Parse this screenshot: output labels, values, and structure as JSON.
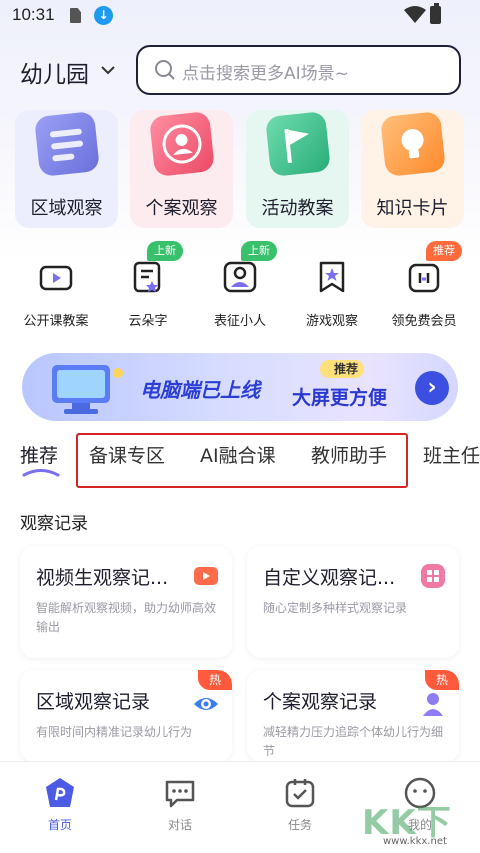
{
  "status_bar": {
    "time": "10:31"
  },
  "header": {
    "location": "幼儿园",
    "search_placeholder": "点击搜索更多AI场景~"
  },
  "scene_cards": [
    {
      "label": "区域观察",
      "bg": "#eceefe",
      "accent": "#7d82e8"
    },
    {
      "label": "个案观察",
      "bg": "#fdecef",
      "accent": "#f2637a"
    },
    {
      "label": "活动教案",
      "bg": "#e6f6f0",
      "accent": "#3dbf8a"
    },
    {
      "label": "知识卡片",
      "bg": "#fff2e6",
      "accent": "#ff9a3c"
    }
  ],
  "quick_entries": [
    {
      "label": "公开课教案",
      "icon": "video-lesson-icon"
    },
    {
      "label": "云朵字",
      "icon": "cloud-text-icon",
      "tag": "上新"
    },
    {
      "label": "表征小人",
      "icon": "figure-icon",
      "tag": "上新"
    },
    {
      "label": "游戏观察",
      "icon": "star-bookmark-icon"
    },
    {
      "label": "领免费会员",
      "icon": "gift-membership-icon",
      "tag": "推荐"
    }
  ],
  "banner": {
    "title": "电脑端已上线",
    "badge": "推荐",
    "subtitle": "大屏更方便"
  },
  "tabs": [
    "推荐",
    "备课专区",
    "AI融合课",
    "教师助手",
    "班主任"
  ],
  "section_title": "观察记录",
  "feature_cards": [
    {
      "title": "视频生观察记...",
      "desc": "智能解析观察视频，助力幼师高效输出"
    },
    {
      "title": "自定义观察记...",
      "desc": "随心定制多种样式观察记录"
    },
    {
      "title": "区域观察记录",
      "desc": "有限时间内精准记录幼儿行为",
      "badge": "热"
    },
    {
      "title": "个案观察记录",
      "desc": "减轻精力压力追踪个体幼儿行为细节",
      "badge": "热"
    }
  ],
  "bottom_nav": [
    {
      "label": "首页",
      "active": true
    },
    {
      "label": "对话"
    },
    {
      "label": "任务"
    },
    {
      "label": "我的"
    }
  ],
  "watermark": {
    "text": "KK下载",
    "url": "www.kkx.net"
  },
  "colors": {
    "accent": "#4b5be3",
    "new_tag": "#39c06b",
    "recommend_tag": "#ff6a3d",
    "hot": "#ff5a3c",
    "highlight_box": "#d42424"
  }
}
